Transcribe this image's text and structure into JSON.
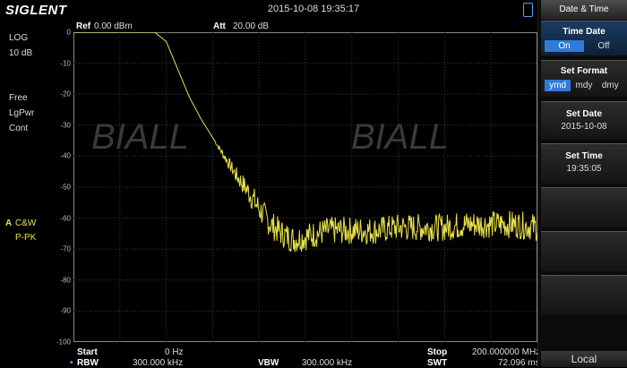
{
  "header": {
    "logo": "SIGLENT",
    "datetime": "2015-10-08   19:35:17"
  },
  "left_panel": {
    "scale_type": "LOG",
    "scale_div": "10 dB",
    "trigger": "Free",
    "detector_mode": "LgPwr",
    "sweep_mode": "Cont",
    "trace_letter": "A",
    "trace_mode": "C&W",
    "trace_detector": "P-PK"
  },
  "display": {
    "ref_label": "Ref",
    "ref_value": "0.00 dBm",
    "att_label": "Att",
    "att_value": "20.00 dB",
    "y_ticks": [
      "0",
      "-10",
      "-20",
      "-30",
      "-40",
      "-50",
      "-60",
      "-70",
      "-80",
      "-90",
      "-100"
    ],
    "watermark": "BIALL",
    "trace_color": "#e8e04a",
    "grid_color": "#3a3a3a"
  },
  "footer": {
    "start_label": "Start",
    "start_value": "0 Hz",
    "rbw_label": "RBW",
    "rbw_value": "300.000 kHz",
    "vbw_label": "VBW",
    "vbw_value": "300.000 kHz",
    "stop_label": "Stop",
    "stop_value": "200.000000 MHz",
    "swt_label": "SWT",
    "swt_value": "72.096 ms"
  },
  "menu": {
    "title": "Date & Time",
    "time_date": {
      "label": "Time Date",
      "options": [
        "On",
        "Off"
      ],
      "selected": "On"
    },
    "set_format": {
      "label": "Set Format",
      "options": [
        "ymd",
        "mdy",
        "dmy"
      ],
      "selected": "ymd"
    },
    "set_date": {
      "label": "Set Date",
      "value": "2015-10-08"
    },
    "set_time": {
      "label": "Set Time",
      "value": "19:35:05"
    },
    "local_label": "Local"
  },
  "chart_data": {
    "type": "line",
    "title": "",
    "xlabel": "",
    "ylabel": "",
    "x_unit": "MHz",
    "y_unit": "dBm",
    "xlim": [
      0,
      200
    ],
    "ylim": [
      -100,
      0
    ],
    "series": [
      {
        "x": [
          0,
          10,
          20,
          30,
          35,
          40,
          45,
          50,
          55,
          60,
          65,
          70,
          75,
          80,
          85,
          90,
          95,
          100,
          105,
          110,
          115,
          120,
          130,
          140,
          150,
          160,
          170,
          180,
          190,
          200
        ],
        "values": [
          0,
          0,
          0,
          0,
          0,
          -3,
          -12,
          -21,
          -28,
          -34,
          -40,
          -46,
          -51,
          -57,
          -62,
          -65,
          -67,
          -66,
          -65,
          -64,
          -64,
          -64,
          -64,
          -63,
          -63,
          -63,
          -62,
          -62,
          -62,
          -63
        ]
      }
    ]
  }
}
